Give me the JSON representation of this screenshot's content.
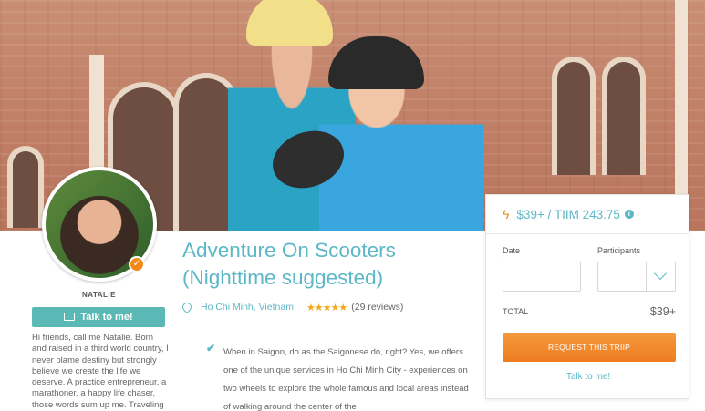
{
  "host": {
    "name": "NATALIE",
    "talk_button": "Talk to me!",
    "bio": "Hi friends, call me Natalie.  Born and raised in a third world country, I never blame destiny but strongly believe we create the life we deserve. A practice entrepreneur, a marathoner, a happy life chaser, those words sum up me. Traveling"
  },
  "trip": {
    "title": "Adventure On Scooters (Nighttime suggested)",
    "location": "Ho Chi Minh, Vietnam",
    "stars": "★★★★★",
    "reviews": "(29 reviews)",
    "description": "When in Saigon, do as the Saigonese do, right? Yes, we offers one of the unique services in Ho Chi Minh City - experiences on two wheels to explore the whole famous and local areas instead of walking around the center of the"
  },
  "booking": {
    "price": "$39+ / TIIM 243.75",
    "date_label": "Date",
    "participants_label": "Participants",
    "total_label": "TOTAL",
    "total_value": "$39+",
    "request_button": "REQUEST THIS TRIIP",
    "talk_link": "Talk to me!"
  },
  "colors": {
    "accent_teal": "#5cb7c6",
    "accent_orange": "#f28a1a"
  }
}
